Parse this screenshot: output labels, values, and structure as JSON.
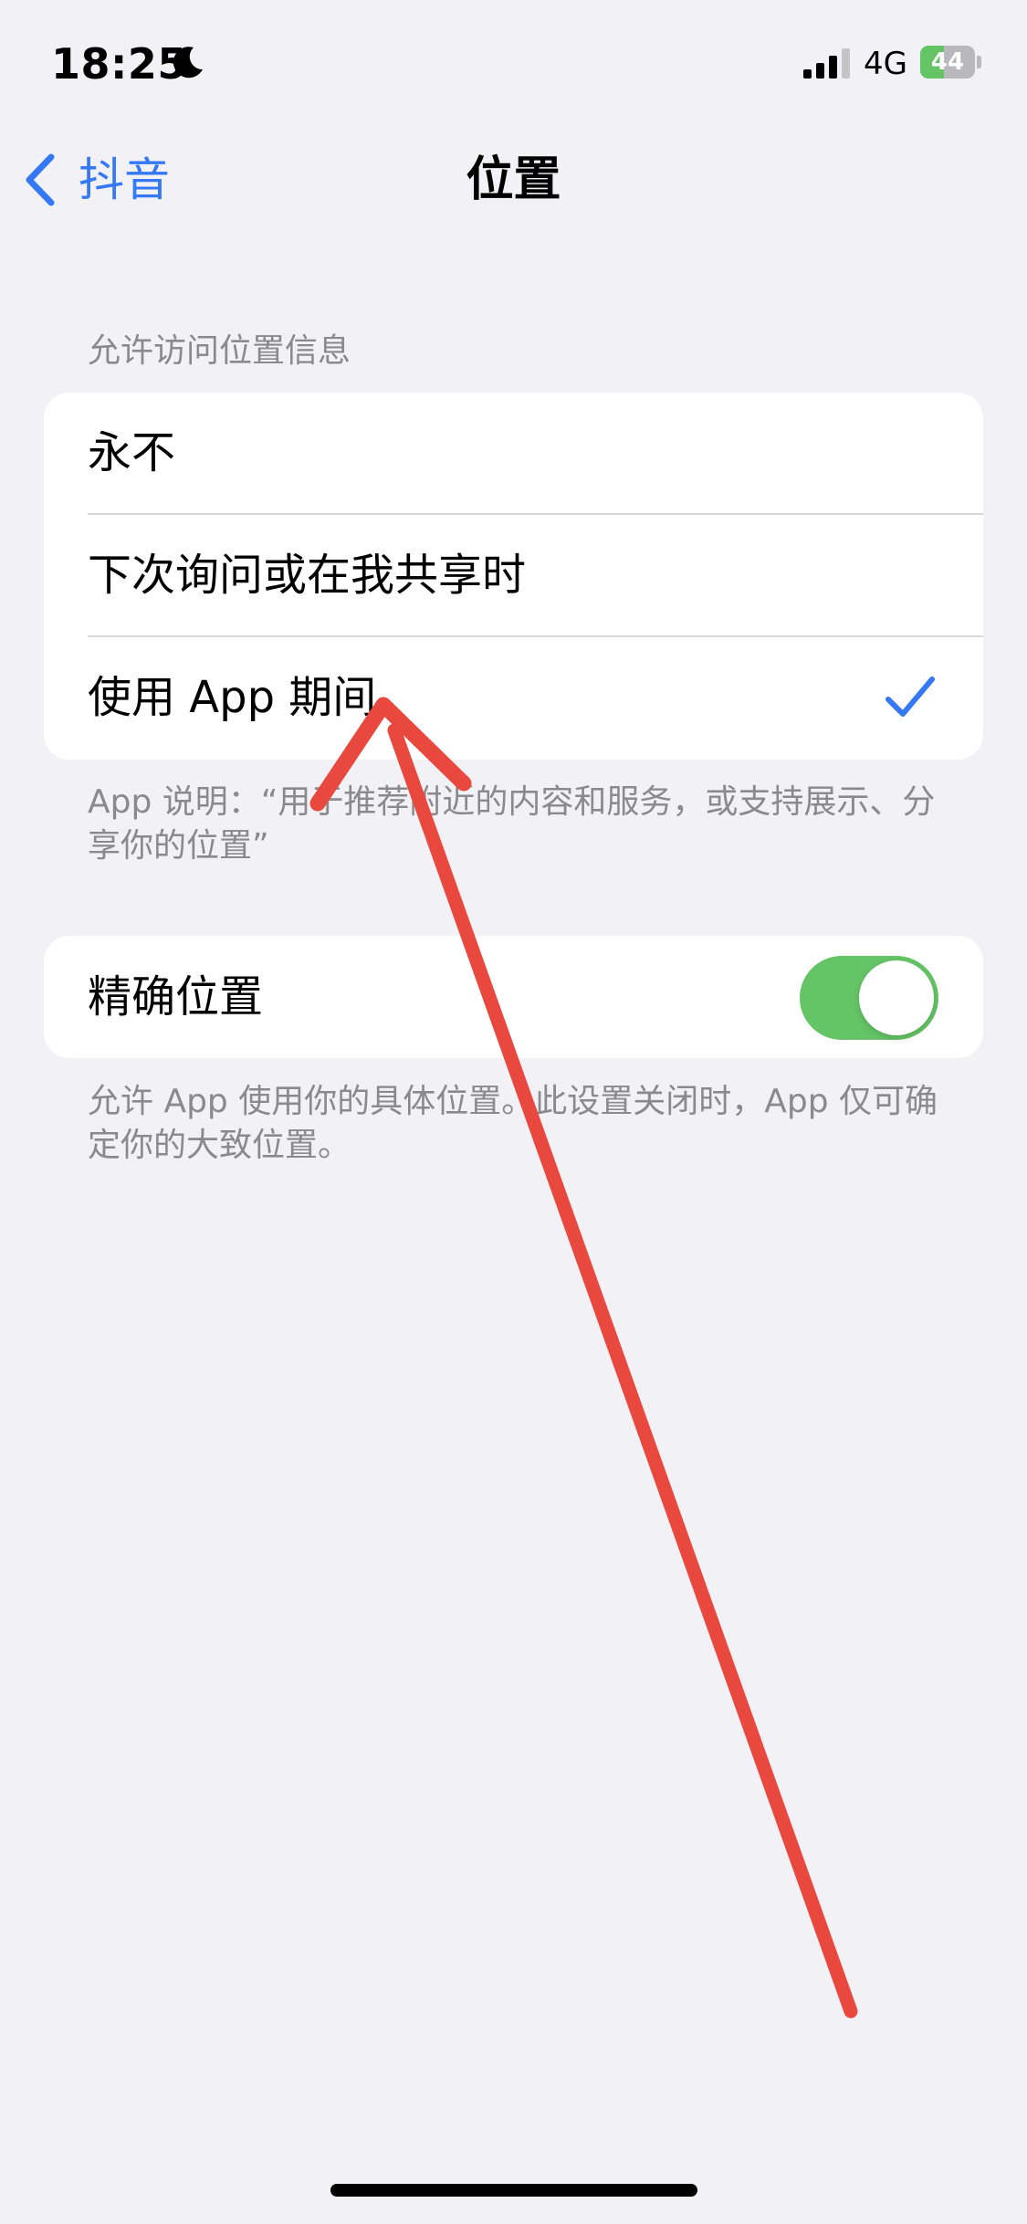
{
  "status_bar": {
    "time": "18:25",
    "network": "4G",
    "battery_level": "44",
    "battery_fraction": 0.44,
    "signal_bars": 3,
    "icons": [
      "moon-icon",
      "signal-icon",
      "battery-icon"
    ]
  },
  "nav": {
    "back_label": "抖音",
    "title": "位置",
    "back_icon": "chevron-left-icon"
  },
  "location_access": {
    "header": "允许访问位置信息",
    "options": [
      {
        "label": "永不",
        "selected": false
      },
      {
        "label": "下次询问或在我共享时",
        "selected": false
      },
      {
        "label": "使用 App 期间",
        "selected": true
      }
    ],
    "footnote": "App 说明：“用于推荐附近的内容和服务，或支持展示、分享你的位置”"
  },
  "precise_location": {
    "label": "精确位置",
    "enabled": true,
    "footnote": "允许 App 使用你的具体位置。此设置关闭时，App 仅可确定你的大致位置。"
  },
  "colors": {
    "background": "#f2f1f6",
    "accent": "#3478f6",
    "toggle_on": "#65c466",
    "annotation_arrow": "#e9483f",
    "secondary_text": "#8a8a8e"
  }
}
